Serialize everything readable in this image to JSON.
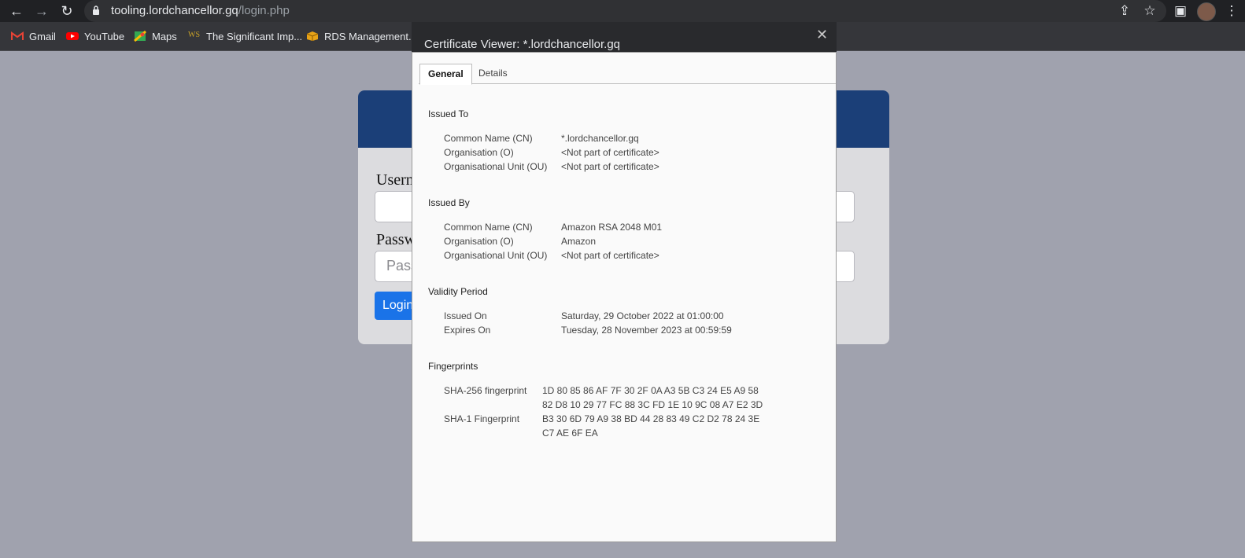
{
  "browser": {
    "url_host": "tooling.lordchancellor.gq",
    "url_path": "/login.php",
    "bookmarks": [
      "Gmail",
      "YouTube",
      "Maps",
      "The Significant Imp...",
      "RDS Management..."
    ]
  },
  "page": {
    "username_label": "Usern",
    "password_label": "Passw",
    "password_placeholder": "Pass",
    "login_label": "Login"
  },
  "dialog": {
    "title": "Certificate Viewer: *.lordchancellor.gq",
    "tabs": [
      "General",
      "Details"
    ],
    "issued_to": {
      "heading": "Issued To",
      "rows": [
        {
          "key": "Common Name (CN)",
          "value": "*.lordchancellor.gq"
        },
        {
          "key": "Organisation (O)",
          "value": "<Not part of certificate>"
        },
        {
          "key": "Organisational Unit (OU)",
          "value": "<Not part of certificate>"
        }
      ]
    },
    "issued_by": {
      "heading": "Issued By",
      "rows": [
        {
          "key": "Common Name (CN)",
          "value": "Amazon RSA 2048 M01"
        },
        {
          "key": "Organisation (O)",
          "value": "Amazon"
        },
        {
          "key": "Organisational Unit (OU)",
          "value": "<Not part of certificate>"
        }
      ]
    },
    "validity": {
      "heading": "Validity Period",
      "rows": [
        {
          "key": "Issued On",
          "value": "Saturday, 29 October 2022 at 01:00:00"
        },
        {
          "key": "Expires On",
          "value": "Tuesday, 28 November 2023 at 00:59:59"
        }
      ]
    },
    "fingerprints": {
      "heading": "Fingerprints",
      "sha256_label": "SHA-256 fingerprint",
      "sha256_line1": "1D 80 85 86 AF 7F 30 2F 0A A3 5B C3 24 E5 A9 58",
      "sha256_line2": "82 D8 10 29 77 FC 88 3C FD 1E 10 9C 08 A7 E2 3D",
      "sha1_label": "SHA-1 Fingerprint",
      "sha1_line1": "B3 30 6D 79 A9 38 BD 44 28 83 49 C2 D2 78 24 3E",
      "sha1_line2": "C7 AE 6F EA"
    }
  }
}
